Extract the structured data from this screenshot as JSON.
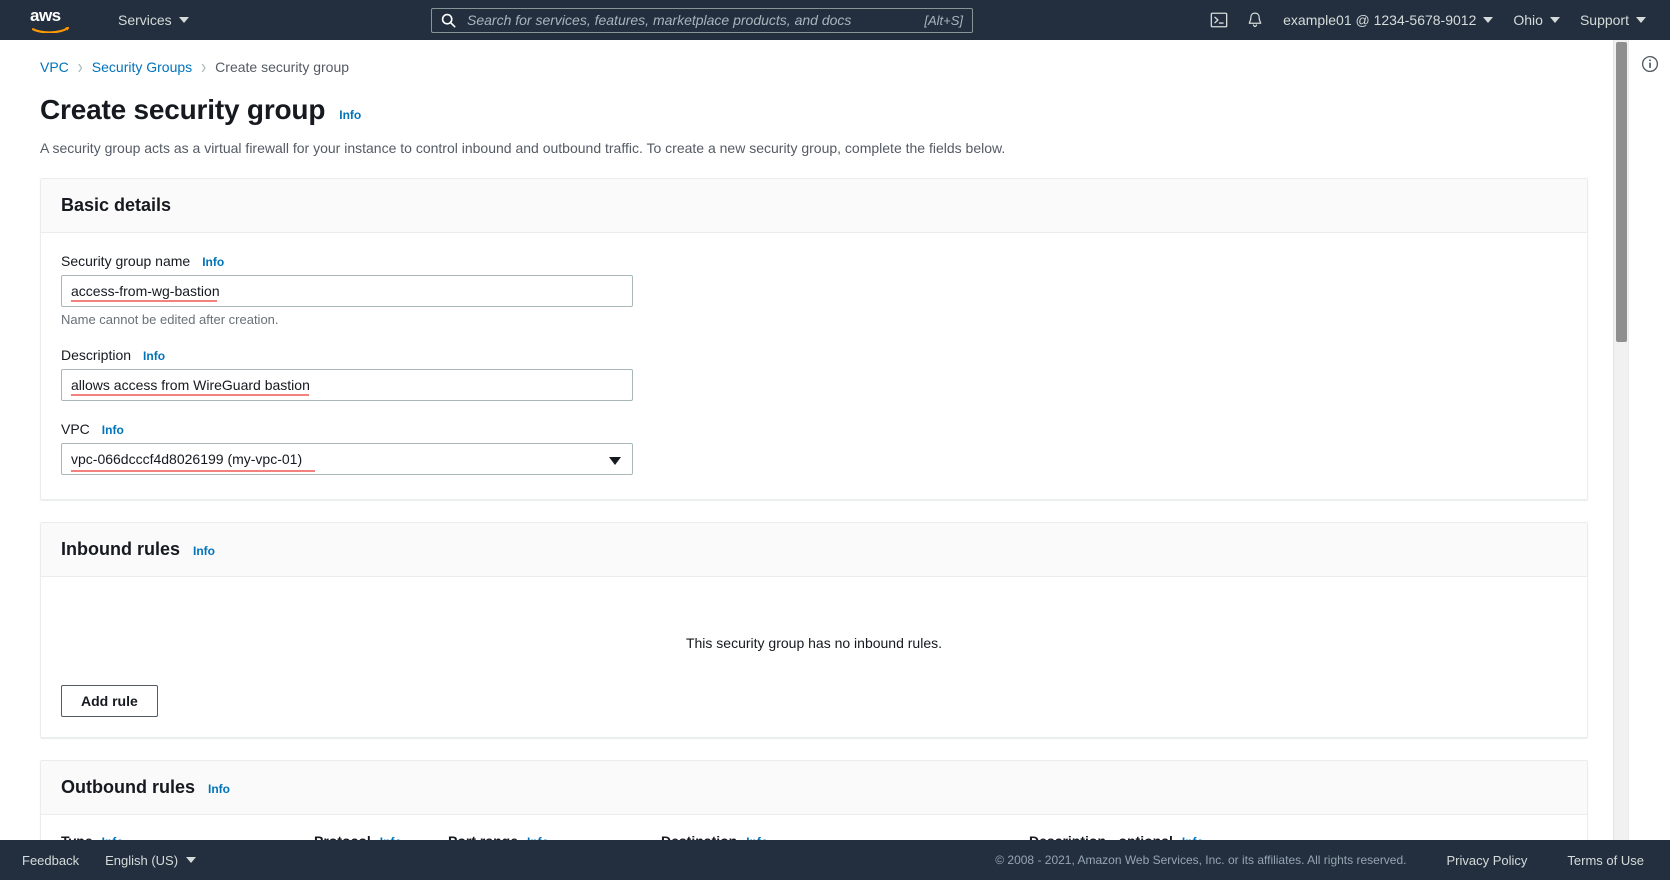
{
  "topnav": {
    "logo_text": "aws",
    "services_label": "Services",
    "search_placeholder": "Search for services, features, marketplace products, and docs",
    "search_value": "",
    "search_shortcut": "[Alt+S]",
    "cloudshell_icon": "cloudshell-icon",
    "notifications_icon": "bell-icon",
    "account_label": "example01 @ 1234-5678-9012",
    "region_label": "Ohio",
    "support_label": "Support"
  },
  "breadcrumb": {
    "items": [
      {
        "label": "VPC",
        "current": false
      },
      {
        "label": "Security Groups",
        "current": false
      },
      {
        "label": "Create security group",
        "current": true
      }
    ],
    "separator": "›"
  },
  "header": {
    "title": "Create security group",
    "info_label": "Info",
    "description": "A security group acts as a virtual firewall for your instance to control inbound and outbound traffic. To create a new security group, complete the fields below."
  },
  "basic_details": {
    "title": "Basic details",
    "name_field": {
      "label": "Security group name",
      "info_label": "Info",
      "value": "access-from-wg-bastion",
      "placeholder": "",
      "hint": "Name cannot be edited after creation."
    },
    "description_field": {
      "label": "Description",
      "info_label": "Info",
      "value": "allows access from WireGuard bastion",
      "placeholder": ""
    },
    "vpc_field": {
      "label": "VPC",
      "info_label": "Info",
      "value": "vpc-066dcccf4d8026199 (my-vpc-01)"
    }
  },
  "inbound_rules": {
    "title": "Inbound rules",
    "info_label": "Info",
    "empty_text": "This security group has no inbound rules.",
    "add_rule_label": "Add rule"
  },
  "outbound_rules": {
    "title": "Outbound rules",
    "info_label": "Info",
    "columns": [
      {
        "label": "Type",
        "info_label": "Info"
      },
      {
        "label": "Protocol",
        "info_label": "Info"
      },
      {
        "label": "Port range",
        "info_label": "Info"
      },
      {
        "label": "Destination",
        "info_label": "Info"
      },
      {
        "label": "Description - optional",
        "info_label": "Info"
      }
    ]
  },
  "right_rail": {
    "info_icon": "info-circle-icon"
  },
  "footer": {
    "feedback_label": "Feedback",
    "language_label": "English (US)",
    "copyright": "© 2008 - 2021, Amazon Web Services, Inc. or its affiliates. All rights reserved.",
    "privacy_label": "Privacy Policy",
    "terms_label": "Terms of Use"
  },
  "colors": {
    "nav_bg": "#232f3e",
    "link_blue": "#0073bb",
    "text_dark": "#16191f",
    "spellcheck_red": "#f3827f"
  }
}
